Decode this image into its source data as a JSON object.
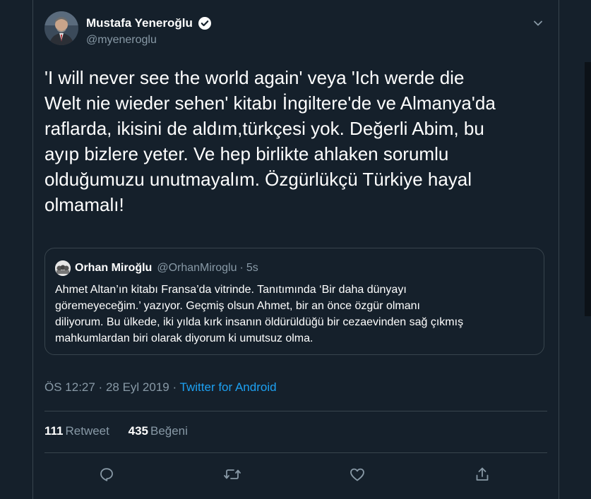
{
  "author": {
    "name": "Mustafa Yeneroğlu",
    "handle": "@myeneroglu",
    "verified_icon": "verified-badge-icon"
  },
  "tweet": {
    "text": "'I will never see the world again' veya 'Ich werde die\nWelt nie wieder sehen' kitabı İngiltere'de ve Almanya'da\nraflarda, ikisini de aldım,türkçesi yok. Değerli Abim, bu\nayıp bizlere yeter. Ve hep birlikte ahlaken sorumlu\nolduğumuzu unutmayalım. Özgürlükçü Türkiye hayal\nolmamalı!"
  },
  "quote": {
    "name": "Orhan Miroğlu",
    "handle": "@OrhanMiroglu",
    "separator": "·",
    "time": "5s",
    "text": "Ahmet Altan’ın kitabı Fransa’da vitrinde. Tanıtımında ‘Bir daha dünyayı\ngöremeyeceğim.’ yazıyor. Geçmiş olsun Ahmet, bir an önce özgür olmanı\ndiliyorum. Bu ülkede, iki yılda kırk insanın öldürüldüğü bir cezaevinden sağ çıkmış\nmahkumlardan biri olarak diyorum ki umutsuz olma."
  },
  "meta": {
    "time": "ÖS 12:27",
    "separator": " · ",
    "date": "28 Eyl 2019",
    "source": "Twitter for Android"
  },
  "stats": {
    "retweets_count": "111",
    "retweets_label": "Retweet",
    "likes_count": "435",
    "likes_label": "Beğeni"
  },
  "actions": [
    "reply-icon",
    "retweet-icon",
    "like-icon",
    "share-icon"
  ],
  "colors": {
    "background": "#15202b",
    "border": "#38444d",
    "text": "#ffffff",
    "secondary": "#8899a6",
    "accent": "#1da1f2"
  }
}
